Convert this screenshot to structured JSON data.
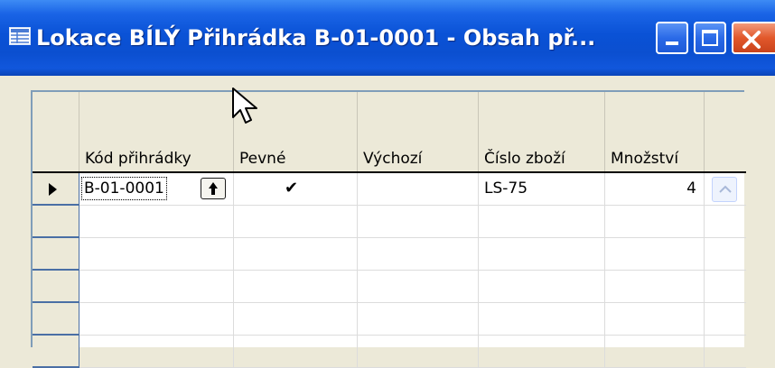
{
  "window": {
    "title": "Lokace BÍLÝ Přihrádka B-01-0001 - Obsah př...",
    "icon": "table-window-icon",
    "controls": {
      "minimize": "minimize-icon",
      "maximize": "maximize-icon",
      "close": "close-icon"
    }
  },
  "grid": {
    "columns": [
      {
        "key": "kod",
        "label": "Kód přihrádky"
      },
      {
        "key": "pevne",
        "label": "Pevné"
      },
      {
        "key": "vychozi",
        "label": "Výchozí"
      },
      {
        "key": "cislo",
        "label": "Číslo zboží"
      },
      {
        "key": "mnozstvi",
        "label": "Množství"
      }
    ],
    "rows": [
      {
        "kod": "B-01-0001",
        "pevne": "✔",
        "vychozi": "",
        "cislo": "LS-75",
        "mnozstvi": "4",
        "current": true
      },
      {
        "kod": "",
        "pevne": "",
        "vychozi": "",
        "cislo": "",
        "mnozstvi": ""
      },
      {
        "kod": "",
        "pevne": "",
        "vychozi": "",
        "cislo": "",
        "mnozstvi": ""
      },
      {
        "kod": "",
        "pevne": "",
        "vychozi": "",
        "cislo": "",
        "mnozstvi": ""
      },
      {
        "kod": "",
        "pevne": "",
        "vychozi": "",
        "cislo": "",
        "mnozstvi": ""
      },
      {
        "kod": "",
        "pevne": "",
        "vychozi": "",
        "cislo": "",
        "mnozstvi": ""
      }
    ]
  },
  "colors": {
    "titlebar": "#0b4fd0",
    "close": "#e2582b",
    "grid_header": "#ece9d8"
  }
}
